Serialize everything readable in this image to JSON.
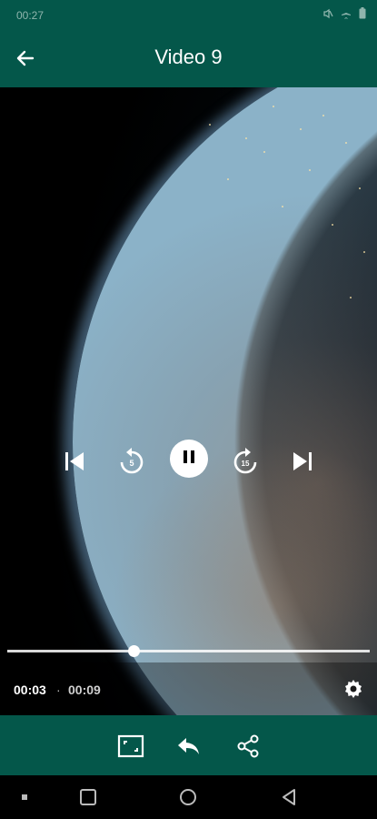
{
  "status_bar": {
    "time": "00:27",
    "icons": [
      "mute-icon",
      "airplane-icon",
      "battery-icon"
    ]
  },
  "app_bar": {
    "title": "Video 9",
    "back_icon": "arrow-left-icon"
  },
  "player": {
    "controls": [
      "skip-previous-icon",
      "replay-5-icon",
      "pause-icon",
      "forward-15-icon",
      "skip-next-icon"
    ],
    "replay_label": "5",
    "forward_label": "15",
    "current_time": "00:03",
    "separator": "·",
    "duration": "00:09",
    "progress": 0.35
  },
  "actions": [
    "aspect-ratio-icon",
    "reply-icon",
    "share-icon"
  ],
  "system_nav": [
    "recents-dot-icon",
    "overview-square-icon",
    "home-circle-icon",
    "back-triangle-icon"
  ],
  "colors": {
    "primary": "#04574a",
    "accent": "#ffffff"
  }
}
